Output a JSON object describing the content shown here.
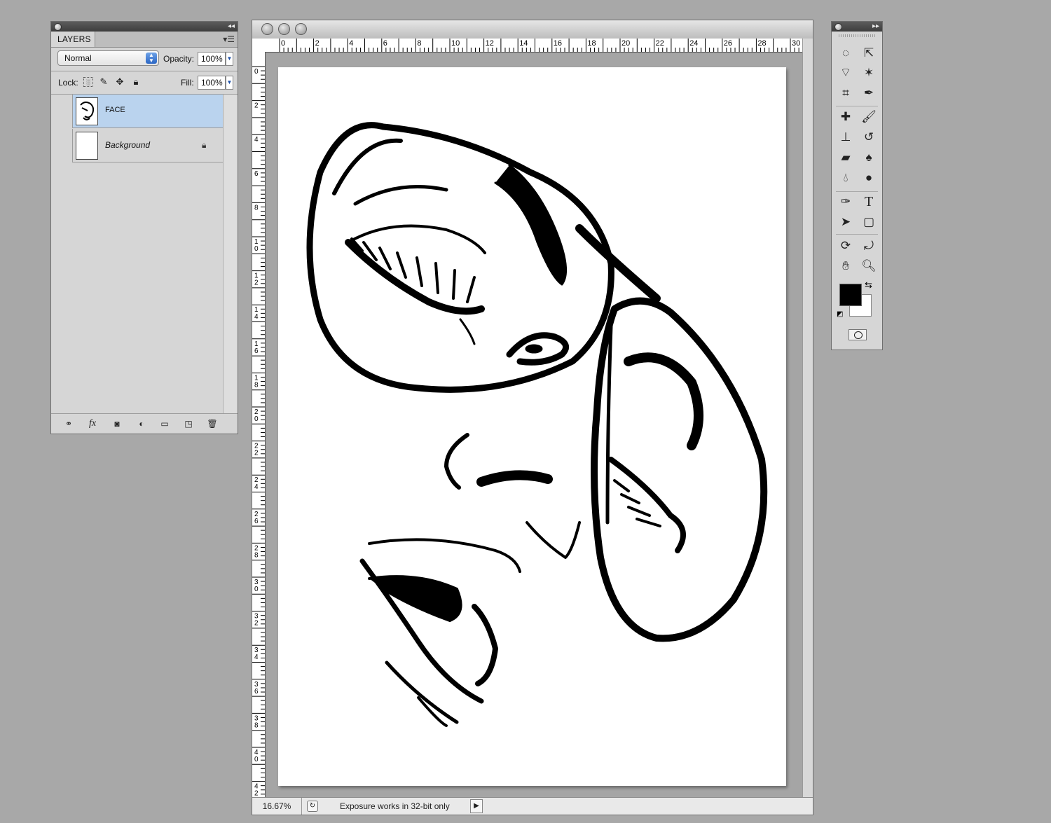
{
  "layers_panel": {
    "tab_label": "LAYERS",
    "blend_mode": "Normal",
    "opacity_label": "Opacity:",
    "opacity_value": "100%",
    "lock_label": "Lock:",
    "fill_label": "Fill:",
    "fill_value": "100%",
    "layers": [
      {
        "name": "FACE",
        "selected": true
      },
      {
        "name": "Background",
        "locked": true
      }
    ],
    "footer_icons": [
      "link-layers-icon",
      "fx-icon",
      "add-mask-icon",
      "adjustment-layer-icon",
      "new-group-icon",
      "new-layer-icon",
      "trash-icon"
    ]
  },
  "document": {
    "ruler_h_labels": [
      "0",
      "2",
      "4",
      "6",
      "8",
      "10",
      "12",
      "14",
      "16",
      "18",
      "20",
      "22",
      "24",
      "26",
      "28",
      "30"
    ],
    "ruler_v_labels": [
      "0",
      "2",
      "4",
      "6",
      "8",
      "10",
      "12",
      "14",
      "16",
      "18",
      "20",
      "22",
      "24",
      "26",
      "28",
      "30",
      "32",
      "34",
      "36",
      "38",
      "40",
      "42"
    ],
    "zoom": "16.67%",
    "status_message": "Exposure works in 32-bit only"
  },
  "tools_panel": {
    "tools": [
      "marquee-tool",
      "move-tool",
      "lasso-tool",
      "magic-wand-tool",
      "crop-tool",
      "eyedropper-tool",
      "healing-brush-tool",
      "brush-tool",
      "clone-stamp-tool",
      "history-brush-tool",
      "eraser-tool",
      "paint-bucket-tool",
      "blur-tool",
      "dodge-tool",
      "pen-tool",
      "type-tool",
      "path-selection-tool",
      "shape-tool",
      "3d-rotate-tool",
      "3d-orbit-tool",
      "hand-tool",
      "zoom-tool"
    ],
    "foreground_color": "#000000",
    "background_color": "#ffffff"
  },
  "colors": {
    "app_background": "#a8a8a8",
    "selected_layer": "#bad3ee"
  }
}
